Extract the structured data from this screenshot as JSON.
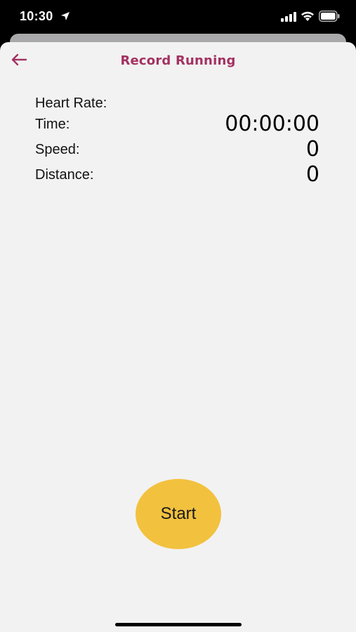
{
  "status_bar": {
    "time": "10:30",
    "icons": [
      "location-arrow-icon",
      "cellular-signal-icon",
      "wifi-icon",
      "battery-icon"
    ]
  },
  "nav": {
    "title": "Record Running",
    "back_icon": "back-arrow-icon"
  },
  "metrics": [
    {
      "label": "Heart Rate:",
      "value": ""
    },
    {
      "label": "Time:",
      "value": "00:00:00"
    },
    {
      "label": "Speed:",
      "value": "0"
    },
    {
      "label": "Distance:",
      "value": "0"
    }
  ],
  "start_button": {
    "label": "Start"
  },
  "colors": {
    "accent": "#a33262",
    "start_button": "#f2c13e",
    "background": "#f2f2f2"
  }
}
